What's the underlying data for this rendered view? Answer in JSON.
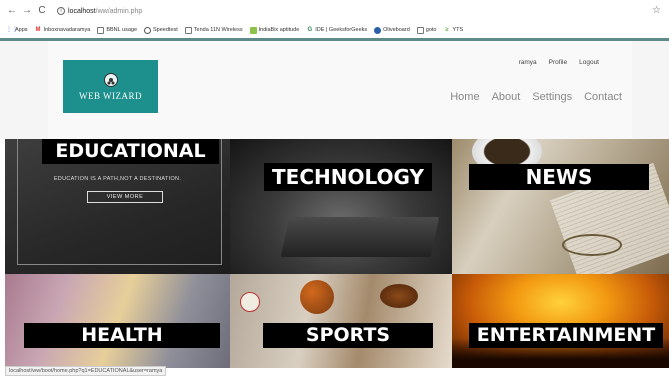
{
  "browser": {
    "url_host": "localhost",
    "url_path": "/ww/admin.php",
    "bookmarks": [
      {
        "label": "Apps",
        "icon": "apps-grid-icon"
      },
      {
        "label": "Inboxnavadaramya",
        "icon": "gmail-icon"
      },
      {
        "label": "BBNL usage",
        "icon": "page-icon"
      },
      {
        "label": "Speedtest",
        "icon": "speedtest-icon"
      },
      {
        "label": "Tenda 11N Wireless",
        "icon": "page-icon"
      },
      {
        "label": "IndiaBix aptitude",
        "icon": "indiabix-icon"
      },
      {
        "label": "IDE | GeeksforGeeks",
        "icon": "geeksforgeeks-icon"
      },
      {
        "label": "Oliveboard",
        "icon": "oliveboard-icon"
      },
      {
        "label": "goto",
        "icon": "page-icon"
      },
      {
        "label": "YTS",
        "icon": "yts-icon"
      }
    ]
  },
  "header": {
    "logo_text": "WEB WIZARD",
    "user_links": [
      "ramya",
      "Profile",
      "Logout"
    ],
    "nav": [
      "Home",
      "About",
      "Settings",
      "Contact"
    ]
  },
  "tiles": {
    "educational": {
      "title": "EDUCATIONAL",
      "tagline": "EDUCATION IS A PATH,NOT A DESTINATION.",
      "button": "VIEW MORE"
    },
    "technology": {
      "title": "TECHNOLOGY"
    },
    "news": {
      "title": "NEWS"
    },
    "health": {
      "title": "HEALTH"
    },
    "sports": {
      "title": "SPORTS"
    },
    "entertainment": {
      "title": "ENTERTAINMENT"
    }
  },
  "status_bar": "localhost/ww/boot/home.php?q1=EDUCATIONAL&user=ramya",
  "colors": {
    "brand_teal": "#1d8f8c",
    "accent_line": "#5e8a89"
  }
}
